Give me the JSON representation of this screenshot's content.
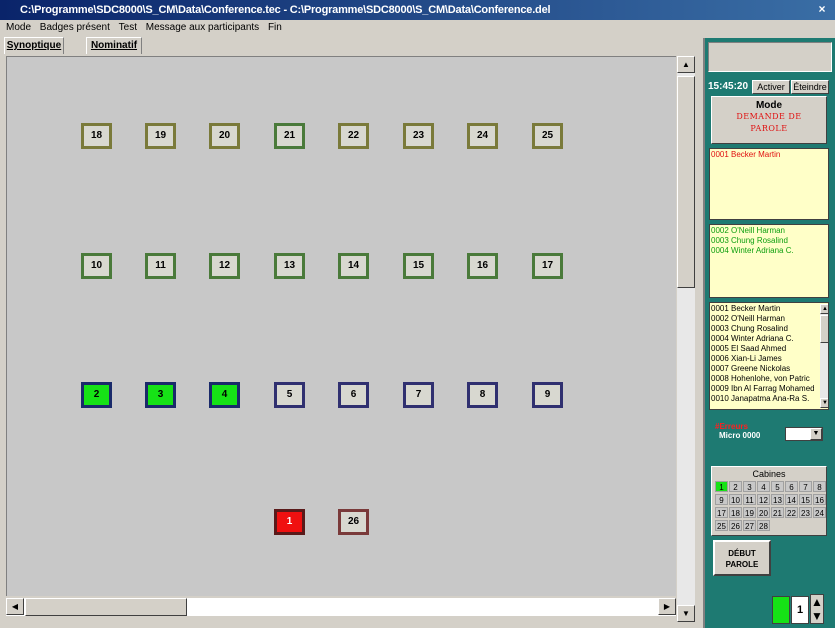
{
  "window": {
    "title": "C:\\Programme\\SDC8000\\S_CM\\Data\\Conference.tec - C:\\Programme\\SDC8000\\S_CM\\Data\\Conference.del",
    "close_label": "×"
  },
  "menu": [
    "Mode",
    "Badges présent",
    "Test",
    "Message aux participants",
    "Fin"
  ],
  "tabs": [
    {
      "label": "Synoptique"
    },
    {
      "label": "Nominatif"
    }
  ],
  "seats": [
    {
      "label": "18",
      "state": "olive"
    },
    {
      "label": "19",
      "state": "olive"
    },
    {
      "label": "20",
      "state": "olive"
    },
    {
      "label": "21",
      "state": "green"
    },
    {
      "label": "22",
      "state": "olive"
    },
    {
      "label": "23",
      "state": "olive"
    },
    {
      "label": "24",
      "state": "olive"
    },
    {
      "label": "25",
      "state": "olive"
    },
    {
      "label": "10",
      "state": "green"
    },
    {
      "label": "11",
      "state": "green"
    },
    {
      "label": "12",
      "state": "green"
    },
    {
      "label": "13",
      "state": "green"
    },
    {
      "label": "14",
      "state": "green"
    },
    {
      "label": "15",
      "state": "green"
    },
    {
      "label": "16",
      "state": "green"
    },
    {
      "label": "17",
      "state": "green"
    },
    {
      "label": "2",
      "state": "active-green"
    },
    {
      "label": "3",
      "state": "active-green"
    },
    {
      "label": "4",
      "state": "active-green"
    },
    {
      "label": "5",
      "state": "navy"
    },
    {
      "label": "6",
      "state": "navy"
    },
    {
      "label": "7",
      "state": "navy"
    },
    {
      "label": "8",
      "state": "navy"
    },
    {
      "label": "9",
      "state": "navy"
    },
    {
      "label": "1",
      "state": "active-red"
    },
    {
      "label": "26",
      "state": "maroon"
    }
  ],
  "panel": {
    "time": "15:45:20",
    "activate_label": "Activer",
    "off_label": "Éteindre",
    "mode_label": "Mode",
    "mode_value_1": "DEMANDE DE",
    "mode_value_2": "PAROLE",
    "speaking": [
      "0001 Becker  Martin"
    ],
    "requests": [
      "0002 O'Neill  Harman",
      "0003 Chung  Rosalind",
      "0004 Winter  Adriana C."
    ],
    "participants": [
      "0001 Becker Martin",
      "0002 O'Neill Harman",
      "0003 Chung Rosalind",
      "0004 Winter Adriana C.",
      "0005 El Saad Ahmed",
      "0006 Xian-Li James",
      "0007 Greene Nickolas",
      "0008 Hohenlohe, von Patric",
      "0009 Ibn Al Farrag Mohamed",
      "0010 Janapatma Ana-Ra S."
    ],
    "errors_title": "#Erreurs",
    "errors_micro": "Micro 0000",
    "cabines_label": "Cabines",
    "cabines": [
      "1",
      "2",
      "3",
      "4",
      "5",
      "6",
      "7",
      "8",
      "9",
      "10",
      "11",
      "12",
      "13",
      "14",
      "15",
      "16",
      "17",
      "18",
      "19",
      "20",
      "21",
      "22",
      "23",
      "24",
      "25",
      "26",
      "27",
      "28"
    ],
    "cabines_active": "1",
    "debut_line1": "DÉBUT",
    "debut_line2": "PAROLE",
    "counter": "1",
    "colors": {
      "panel_bg": "#1e7a72",
      "active_green": "#16e216",
      "active_red": "#f01010",
      "list_bg": "#ffffc8"
    }
  }
}
